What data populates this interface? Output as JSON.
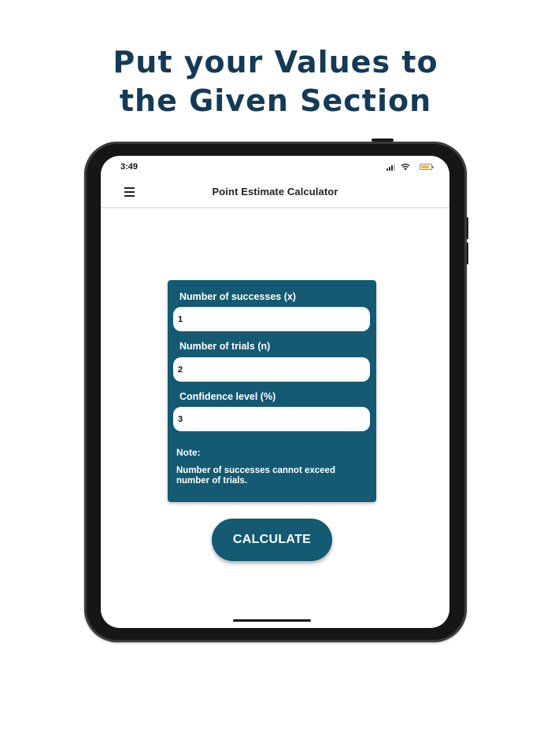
{
  "headline": {
    "line1": "Put your Values to",
    "line2": "the Given Section"
  },
  "status_bar": {
    "time": "3:49",
    "icons": [
      "signal-icon",
      "wifi-icon",
      "battery-icon"
    ],
    "battery_color": "#f2c200"
  },
  "appbar": {
    "menu_icon": "hamburger-menu-icon",
    "title": "Point Estimate Calculator"
  },
  "form": {
    "accent_color": "#135a72",
    "fields": [
      {
        "label": "Number of successes (x)",
        "value": "1"
      },
      {
        "label": "Number of trials (n)",
        "value": "2"
      },
      {
        "label": "Confidence level (%)",
        "value": "3"
      }
    ],
    "note_title": "Note:",
    "note_text": "Number of successes cannot exceed number of trials."
  },
  "calculate_label": "CALCULATE"
}
